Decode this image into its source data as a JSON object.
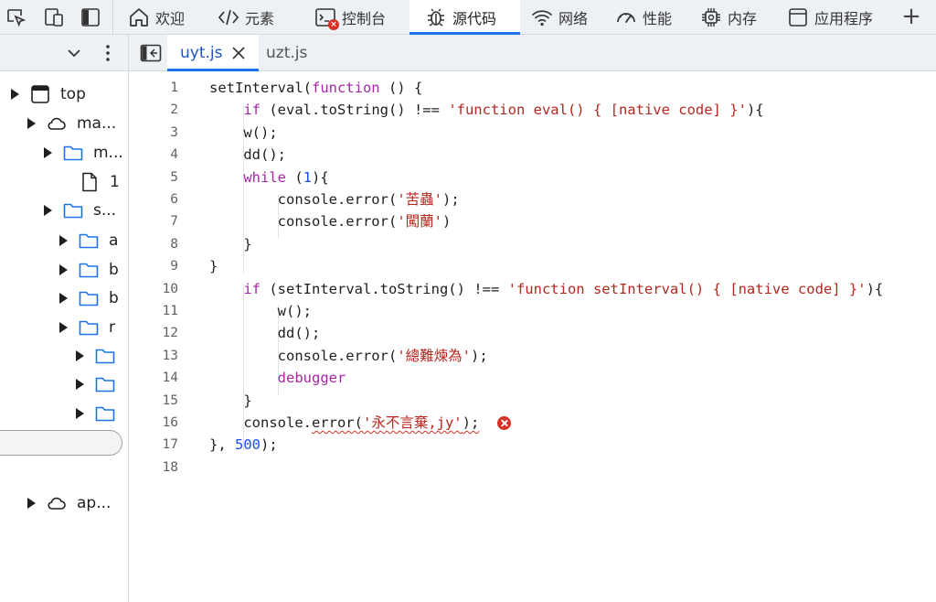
{
  "toolbar": {
    "tabs": [
      {
        "label": "欢迎",
        "icon": "home-icon"
      },
      {
        "label": "元素",
        "icon": "code-brackets-icon"
      },
      {
        "label": "控制台",
        "icon": "console-icon"
      },
      {
        "label": "源代码",
        "icon": "bug-icon"
      },
      {
        "label": "网络",
        "icon": "wifi-icon"
      },
      {
        "label": "性能",
        "icon": "gauge-icon"
      },
      {
        "label": "内存",
        "icon": "chip-icon"
      },
      {
        "label": "应用程序",
        "icon": "app-window-icon"
      }
    ],
    "console_error_badge": "×",
    "add_label": "+"
  },
  "navigator": {
    "items": [
      {
        "label": "top",
        "icon": "window-icon"
      },
      {
        "label": "ma...",
        "icon": "cloud-icon"
      },
      {
        "label": "m...",
        "icon": "folder-icon"
      },
      {
        "label": "1",
        "icon": "file-icon"
      },
      {
        "label": "s...",
        "icon": "folder-icon"
      },
      {
        "label": "a",
        "icon": "folder-icon"
      },
      {
        "label": "b",
        "icon": "folder-icon"
      },
      {
        "label": "b",
        "icon": "folder-icon"
      },
      {
        "label": "r",
        "icon": "folder-icon"
      },
      {
        "label": "",
        "icon": "folder-icon"
      },
      {
        "label": "",
        "icon": "folder-icon"
      },
      {
        "label": "",
        "icon": "folder-icon"
      },
      {
        "label": "ap...",
        "icon": "cloud-icon"
      }
    ]
  },
  "editor": {
    "tabs": [
      {
        "label": "uyt.js",
        "active": true
      },
      {
        "label": "uzt.js",
        "active": false
      }
    ],
    "lines": [
      [
        [
          "setInterval(",
          "p"
        ],
        [
          "function",
          "kw"
        ],
        [
          " () {",
          "p"
        ]
      ],
      [
        [
          "    ",
          "p"
        ],
        [
          "if",
          "kw"
        ],
        [
          " (eval.toString() !== ",
          "p"
        ],
        [
          "'function eval() { [native code] }'",
          "str"
        ],
        [
          "){",
          "p"
        ]
      ],
      [
        [
          "    w();",
          "p"
        ]
      ],
      [
        [
          "    dd();",
          "p"
        ]
      ],
      [
        [
          "    ",
          "p"
        ],
        [
          "while",
          "kw"
        ],
        [
          " (",
          "p"
        ],
        [
          "1",
          "num"
        ],
        [
          "){",
          "p"
        ]
      ],
      [
        [
          "        console.error(",
          "p"
        ],
        [
          "'苦蟲'",
          "str"
        ],
        [
          ");",
          "p"
        ]
      ],
      [
        [
          "        console.error(",
          "p"
        ],
        [
          "'闖蘭'",
          "str"
        ],
        [
          ")",
          "p"
        ]
      ],
      [
        [
          "    }",
          "p"
        ]
      ],
      [
        [
          "}",
          "p"
        ]
      ],
      [
        [
          "    ",
          "p"
        ],
        [
          "if",
          "kw"
        ],
        [
          " (setInterval.toString() !== ",
          "p"
        ],
        [
          "'function setInterval() { [native code] }'",
          "str"
        ],
        [
          "){",
          "p"
        ]
      ],
      [
        [
          "        w();",
          "p"
        ]
      ],
      [
        [
          "        dd();",
          "p"
        ]
      ],
      [
        [
          "        console.error(",
          "p"
        ],
        [
          "'總難煉為'",
          "str"
        ],
        [
          ");",
          "p"
        ]
      ],
      [
        [
          "        ",
          "p"
        ],
        [
          "debugger",
          "kw"
        ]
      ],
      [
        [
          "    }",
          "p"
        ]
      ],
      [
        [
          "    console.",
          "p"
        ],
        [
          "error(",
          "sq"
        ],
        [
          "'永不言棄,jy'",
          "sqstr"
        ],
        [
          ");",
          "sq"
        ]
      ],
      [
        [
          "}, ",
          "p"
        ],
        [
          "500",
          "num"
        ],
        [
          ");",
          "p"
        ]
      ],
      [
        [
          "",
          "p"
        ]
      ]
    ],
    "error_line": 16
  }
}
